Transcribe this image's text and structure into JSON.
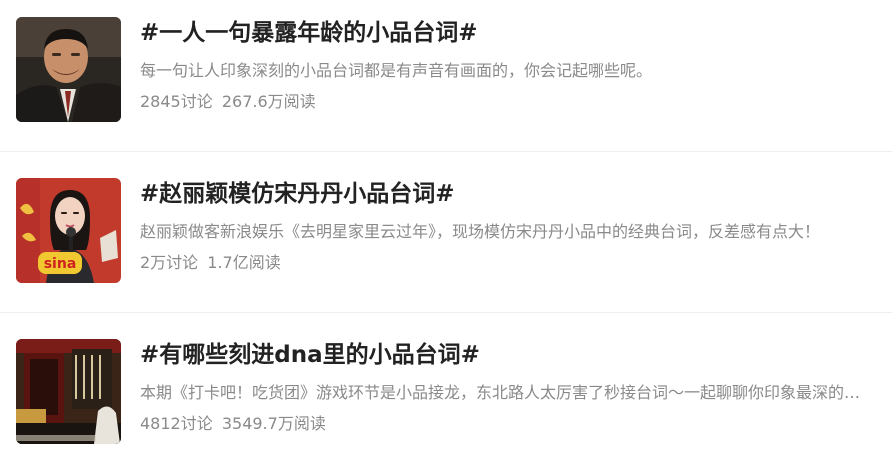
{
  "topics": [
    {
      "title": "#一人一句暴露年龄的小品台词#",
      "description": "每一句让人印象深刻的小品台词都是有声音有画面的，你会记起哪些呢。",
      "discussions": "2845讨论",
      "reads": "267.6万阅读",
      "thumbnail": "man-in-suit-laughing-photo"
    },
    {
      "title": "#赵丽颖模仿宋丹丹小品台词#",
      "description": "赵丽颖做客新浪娱乐《去明星家里云过年》，现场模仿宋丹丹小品中的经典台词，反差感有点大！",
      "discussions": "2万讨论",
      "reads": "1.7亿阅读",
      "thumbnail": "woman-with-sina-microphone-photo",
      "thumb_text": "sina"
    },
    {
      "title": "#有哪些刻进dna里的小品台词#",
      "description": "本期《打卡吧！吃货团》游戏环节是小品接龙，东北路人太厉害了秒接台词～一起聊聊你印象最深的小品台词吧",
      "discussions": "4812讨论",
      "reads": "3549.7万阅读",
      "thumbnail": "stage-performance-photo"
    }
  ]
}
